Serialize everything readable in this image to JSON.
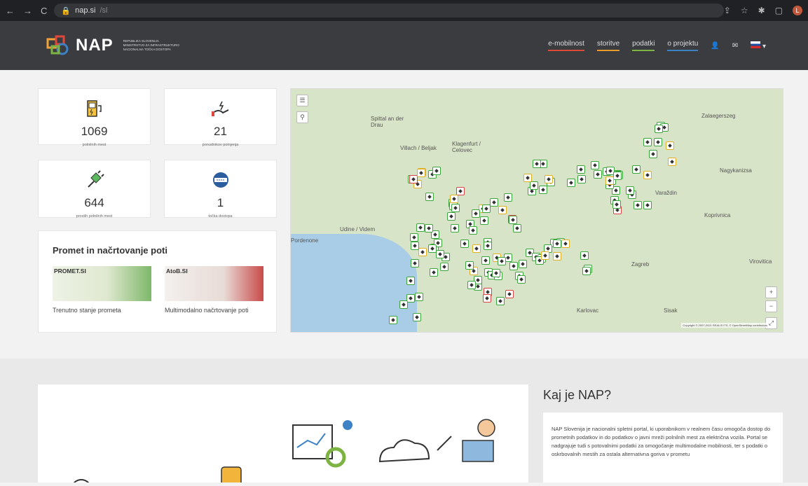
{
  "browser": {
    "url_host": "nap.si",
    "url_path": "/sl"
  },
  "header": {
    "logo_text": "NAP",
    "logo_sub1": "REPUBLIKA SLOVENIJA",
    "logo_sub2": "MINISTRSTVO ZA INFRASTRUKTURO",
    "logo_sub3": "NACIONALNA TOČKA DOSTOPA",
    "nav": [
      "e-mobilnost",
      "storitve",
      "podatki",
      "o projektu"
    ]
  },
  "stats": [
    {
      "value": "1069",
      "label": "polnilnih mest",
      "icon": "charging-station-icon"
    },
    {
      "value": "21",
      "label": "ponudnikov polnjenja",
      "icon": "hand-energy-icon"
    },
    {
      "value": "644",
      "label": "prostih polnilnih mest",
      "icon": "plug-icon"
    },
    {
      "value": "1",
      "label": "točka dostopa",
      "icon": "globe-icon"
    }
  ],
  "traffic": {
    "title": "Promet in načrtovanje poti",
    "tiles": [
      {
        "name": "PROMET.SI",
        "caption": "Trenutno stanje prometa"
      },
      {
        "name": "AtoB.SI",
        "caption": "Multimodalno načrtovanje poti"
      }
    ]
  },
  "map": {
    "labels": [
      "Spittal an der Drau",
      "Villach / Beljak",
      "Klagenfurt / Celovec",
      "Zalaegerszeg",
      "Nagykanizsa",
      "Varaždin",
      "Koprivnica",
      "Udine / Videm",
      "Pordenone",
      "Zagreb",
      "Virovitica",
      "Karlovac",
      "Sisak"
    ],
    "copyright": "Copyright © 2007-2021 REALIS ITS, © OpenStreetMap contributors"
  },
  "about": {
    "title": "Kaj je NAP?",
    "text": "NAP Slovenija je nacionalni spletni portal, ki uporabnikom v realnem času omogoča dostop do prometnih podatkov in do podatkov o javni mreži polnilnih mest za električna vozila. Portal se nadgrajuje tudi s potovalnimi podatki za omogočanje multimodalne mobilnosti, ter s podatki o oskrbovalnih mestih za ostala alternativna goriva v prometu"
  },
  "colors": {
    "header_bg": "#3a3c40",
    "accent_red": "#e0473a",
    "accent_orange": "#e89a2c",
    "accent_green": "#7cb342",
    "accent_blue": "#3d82c4"
  }
}
